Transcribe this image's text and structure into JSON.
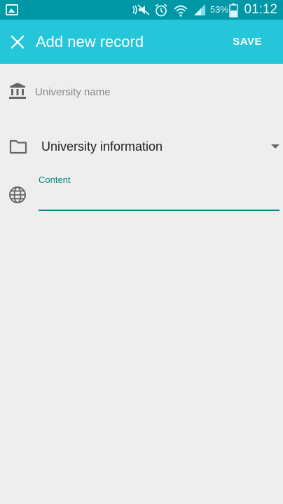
{
  "status_bar": {
    "battery_percent": "53%",
    "time": "01:12",
    "icons": [
      "gallery-icon",
      "mute-icon",
      "alarm-icon",
      "wifi-icon",
      "signal-icon",
      "battery-icon"
    ]
  },
  "app_bar": {
    "title": "Add new record",
    "save_label": "SAVE",
    "close_icon": "close-icon"
  },
  "form": {
    "university_name": {
      "placeholder": "University name",
      "value": "",
      "icon": "bank-icon"
    },
    "category": {
      "selected": "University information",
      "icon": "folder-icon"
    },
    "content": {
      "label": "Content",
      "value": "",
      "icon": "globe-icon"
    }
  },
  "colors": {
    "status_bar": "#0097a7",
    "app_bar": "#26c6da",
    "accent": "#00897b",
    "background": "#eeeeee"
  }
}
